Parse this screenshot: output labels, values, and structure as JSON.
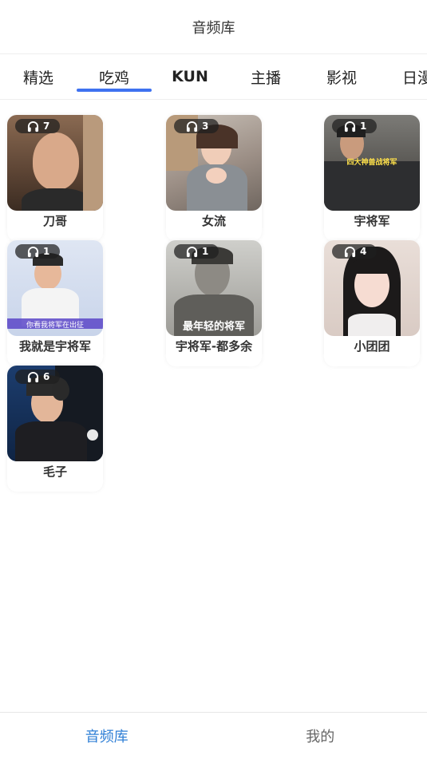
{
  "header": {
    "title": "音频库"
  },
  "tabs": [
    {
      "label": "精选",
      "active": false
    },
    {
      "label": "吃鸡",
      "active": true
    },
    {
      "label": "KUN",
      "active": false
    },
    {
      "label": "主播",
      "active": false
    },
    {
      "label": "影视",
      "active": false
    },
    {
      "label": "日漫",
      "active": false
    }
  ],
  "accent_color": "#3f72f0",
  "cards": [
    {
      "name": "刀哥",
      "count": "7",
      "overlay_text": "",
      "icon": "headphones-icon"
    },
    {
      "name": "女流",
      "count": "3",
      "overlay_text": "",
      "icon": "headphones-icon"
    },
    {
      "name": "宇将军",
      "count": "1",
      "overlay_text": "四大神兽战将军",
      "icon": "headphones-icon"
    },
    {
      "name": "我就是宇将军",
      "count": "1",
      "overlay_text": "你看我将军在出征",
      "icon": "headphones-icon"
    },
    {
      "name": "宇将军-都多余",
      "count": "1",
      "overlay_text": "最年轻的将军",
      "icon": "headphones-icon"
    },
    {
      "name": "小团团",
      "count": "4",
      "overlay_text": "",
      "icon": "headphones-icon"
    },
    {
      "name": "毛子",
      "count": "6",
      "overlay_text": "",
      "icon": "headphones-icon"
    }
  ],
  "bottom_nav": [
    {
      "label": "音频库",
      "active": true,
      "color": "#2f7fd6"
    },
    {
      "label": "我的",
      "active": false,
      "color": "#666666"
    }
  ]
}
